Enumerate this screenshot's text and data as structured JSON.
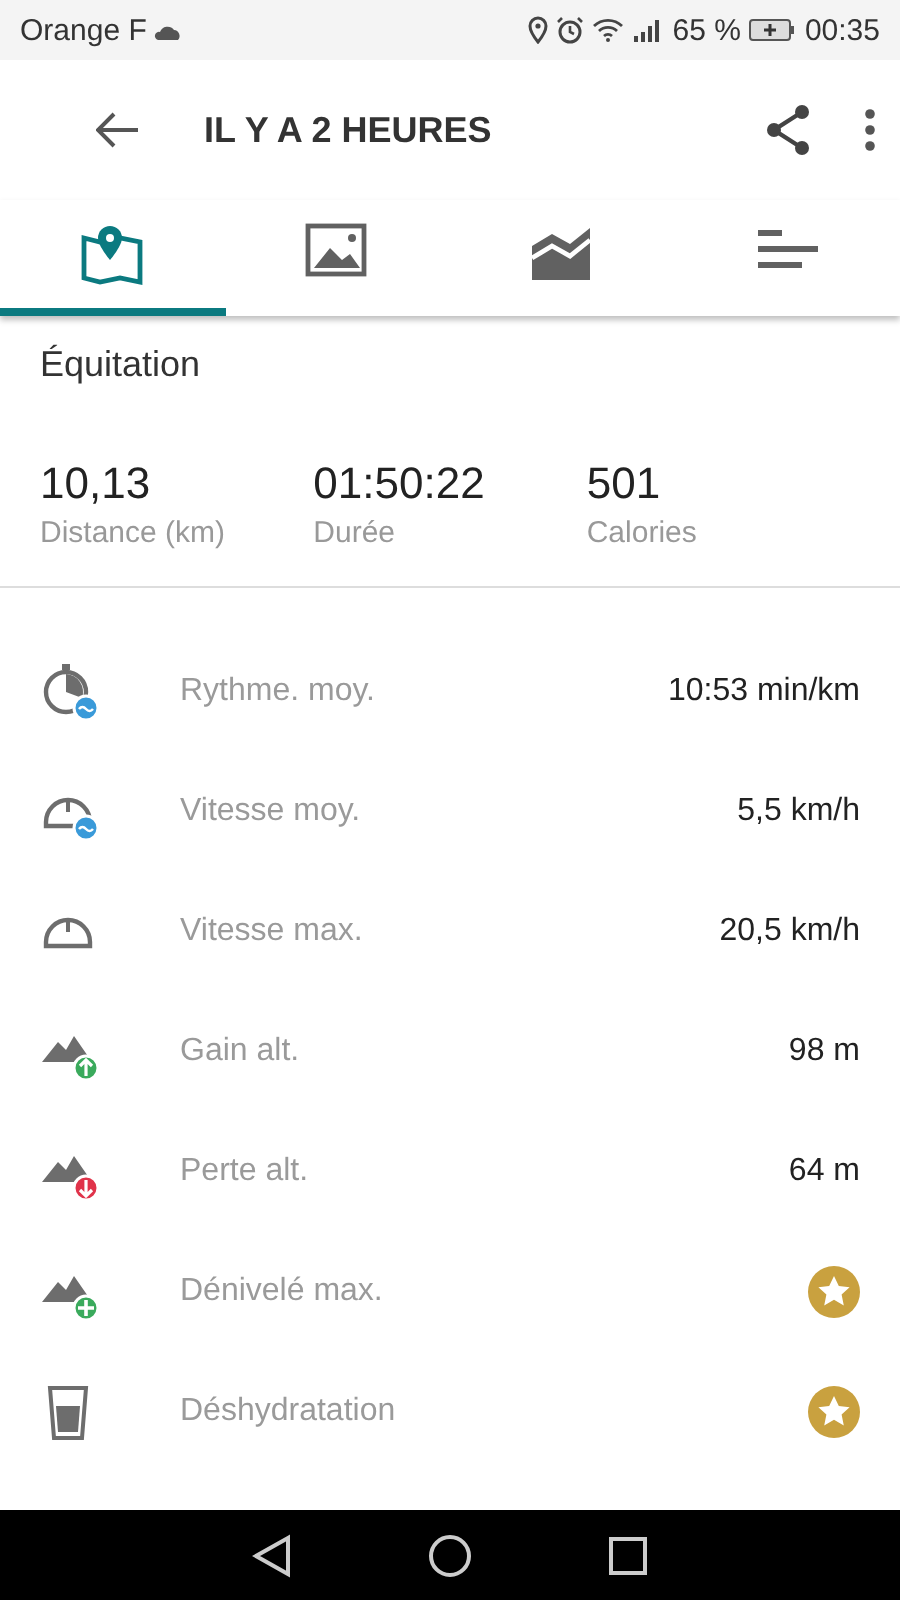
{
  "status_bar": {
    "carrier": "Orange F",
    "battery": "65 %",
    "time": "00:35"
  },
  "toolbar": {
    "title": "IL Y A 2 HEURES"
  },
  "tabs": [
    {
      "kind": "map",
      "selected": true
    },
    {
      "kind": "photo",
      "selected": false
    },
    {
      "kind": "chart",
      "selected": false
    },
    {
      "kind": "list",
      "selected": false
    }
  ],
  "activity": "Équitation",
  "stats": [
    {
      "value": "10,13",
      "label": "Distance (km)"
    },
    {
      "value": "01:50:22",
      "label": "Durée"
    },
    {
      "value": "501",
      "label": "Calories"
    }
  ],
  "rows": [
    {
      "label": "Rythme. moy.",
      "kind": "value",
      "value": "10:53 min/km"
    },
    {
      "label": "Vitesse moy.",
      "kind": "value",
      "value": "5,5 km/h"
    },
    {
      "label": "Vitesse max.",
      "kind": "value",
      "value": "20,5 km/h"
    },
    {
      "label": "Gain alt.",
      "kind": "value",
      "value": "98 m"
    },
    {
      "label": "Perte alt.",
      "kind": "value",
      "value": "64 m"
    },
    {
      "label": "Dénivelé max.",
      "kind": "premium"
    },
    {
      "label": "Déshydratation",
      "kind": "premium"
    }
  ]
}
